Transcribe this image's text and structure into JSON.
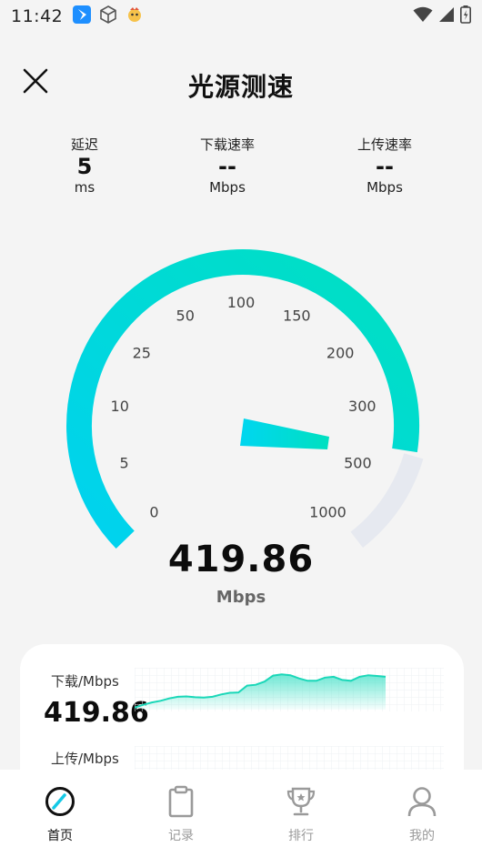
{
  "status_bar": {
    "time": "11:42"
  },
  "header": {
    "title": "光源测速"
  },
  "metrics": {
    "latency": {
      "label": "延迟",
      "value": "5",
      "unit": "ms"
    },
    "download": {
      "label": "下载速率",
      "value": "--",
      "unit": "Mbps"
    },
    "upload": {
      "label": "上传速率",
      "value": "--",
      "unit": "Mbps"
    }
  },
  "gauge": {
    "ticks": [
      "0",
      "5",
      "10",
      "25",
      "50",
      "100",
      "150",
      "200",
      "300",
      "500",
      "1000"
    ],
    "speed": "419.86",
    "unit": "Mbps",
    "accent_start": "#00d2f0",
    "accent_end": "#00e0c0",
    "track_color": "#e6e9f0"
  },
  "card": {
    "download_label": "下载/Mbps",
    "download_value": "419.86",
    "upload_label": "上传/Mbps",
    "download_series": [
      0.05,
      0.12,
      0.18,
      0.22,
      0.28,
      0.32,
      0.33,
      0.31,
      0.3,
      0.32,
      0.38,
      0.42,
      0.43,
      0.6,
      0.62,
      0.7,
      0.85,
      0.88,
      0.86,
      0.78,
      0.72,
      0.72,
      0.8,
      0.82,
      0.74,
      0.72,
      0.82,
      0.86,
      0.84,
      0.82
    ]
  },
  "nav": {
    "items": [
      {
        "label": "首页",
        "icon": "speedometer-icon",
        "active": true
      },
      {
        "label": "记录",
        "icon": "clipboard-icon",
        "active": false
      },
      {
        "label": "排行",
        "icon": "trophy-icon",
        "active": false
      },
      {
        "label": "我的",
        "icon": "person-icon",
        "active": false
      }
    ]
  }
}
